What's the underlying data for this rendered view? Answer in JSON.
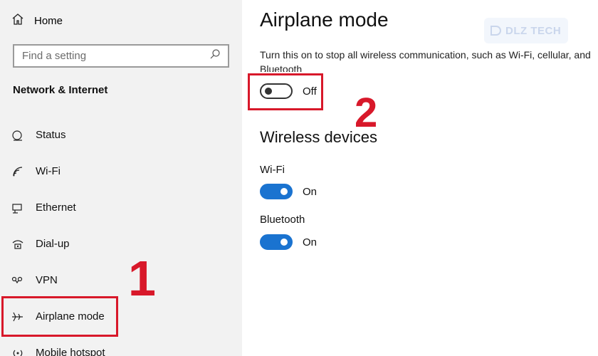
{
  "sidebar": {
    "home_label": "Home",
    "search_placeholder": "Find a setting",
    "section_title": "Network & Internet",
    "items": [
      {
        "label": "Status",
        "icon": "status-icon"
      },
      {
        "label": "Wi-Fi",
        "icon": "wifi-icon"
      },
      {
        "label": "Ethernet",
        "icon": "ethernet-icon"
      },
      {
        "label": "Dial-up",
        "icon": "dial-up-icon"
      },
      {
        "label": "VPN",
        "icon": "vpn-icon"
      },
      {
        "label": "Airplane mode",
        "icon": "airplane-icon"
      },
      {
        "label": "Mobile hotspot",
        "icon": "hotspot-icon"
      }
    ],
    "selected": "Airplane mode"
  },
  "main": {
    "title": "Airplane mode",
    "description": "Turn this on to stop all wireless communication, such as Wi-Fi, cellular, and Bluetooth",
    "airplane_toggle": {
      "state": "Off",
      "on": false
    },
    "wireless_title": "Wireless devices",
    "wifi": {
      "label": "Wi-Fi",
      "state": "On",
      "on": true
    },
    "bluetooth": {
      "label": "Bluetooth",
      "state": "On",
      "on": true
    }
  },
  "annotations": {
    "step1": "1",
    "step2": "2",
    "color": "#d8182a"
  },
  "watermark": {
    "text": "DLZ TECH"
  },
  "colors": {
    "accent": "#1a73d0",
    "sidebar_bg": "#f2f2f2",
    "highlight": "#d8182a"
  }
}
